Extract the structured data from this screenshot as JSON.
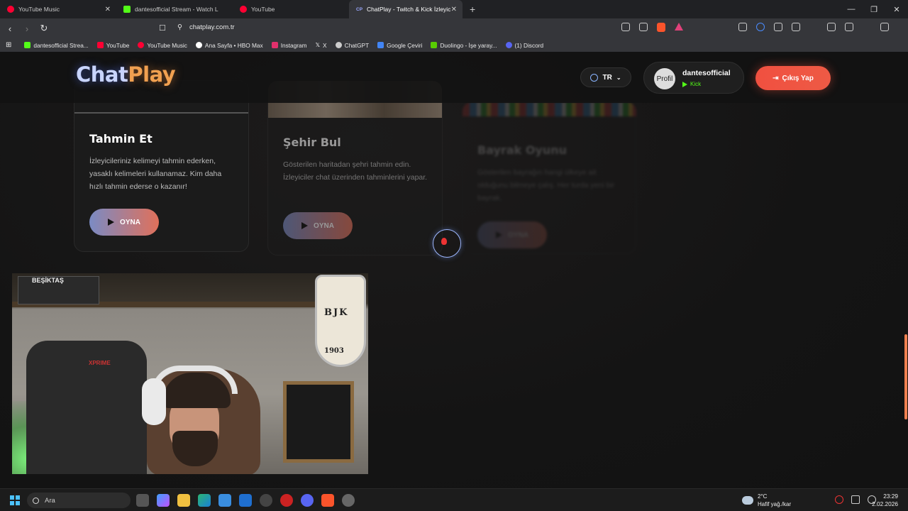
{
  "browser": {
    "tabs": [
      {
        "label": "YouTube Music",
        "color": "#ff0033"
      },
      {
        "label": "dantesofficial Stream - Watch Liv",
        "color": "#53fc18"
      },
      {
        "label": "YouTube",
        "color": "#ff0033"
      },
      {
        "label": "ChatPlay - Twitch & Kick İzleyici",
        "color": "#6b7cff",
        "fav_text": "CP",
        "active": true
      }
    ],
    "new_tab": "+",
    "url": "chatplay.com.tr",
    "bookmarks": [
      {
        "label": "dantesofficial Strea...",
        "color": "#53fc18"
      },
      {
        "label": "YouTube",
        "color": "#ff0033"
      },
      {
        "label": "YouTube Music",
        "color": "#ff0033"
      },
      {
        "label": "Ana Sayfa • HBO Max",
        "color": "#ffffff"
      },
      {
        "label": "Instagram",
        "color": "#e1306c"
      },
      {
        "label": "X",
        "color": "#ffffff"
      },
      {
        "label": "ChatGPT",
        "color": "#cccccc"
      },
      {
        "label": "Google Çeviri",
        "color": "#4285f4"
      },
      {
        "label": "Duolingo - İşe yaray...",
        "color": "#58cc02"
      },
      {
        "label": "(1) Discord",
        "color": "#5865f2"
      }
    ]
  },
  "site": {
    "logo_part1": "Chat",
    "logo_part2": "Play",
    "lang": "TR",
    "profile": {
      "name": "dantesofficial",
      "platform": "Kick",
      "avatar_alt": "Profil"
    },
    "logout_label": "Çıkış Yap",
    "cards": [
      {
        "title": "Tahmin Et",
        "desc": "İzleyicileriniz kelimeyi tahmin ederken, yasaklı kelimeleri kullanamaz. Kim daha hızlı tahmin ederse o kazanır!",
        "play_label": "OYNA"
      },
      {
        "title": "Şehir Bul",
        "desc": "Gösterilen haritadan şehri tahmin edin. İzleyiciler chat üzerinden tahminlerini yapar.",
        "play_label": "OYNA"
      },
      {
        "title": "Bayrak Oyunu",
        "desc": "Gösterilen bayrağın hangi ülkeye ait olduğunu bilmeye çalış. Her turda yeni bir bayrak.",
        "play_label": "OYNA"
      }
    ]
  },
  "webcam": {
    "sign": "BEŞİKTAŞ",
    "shield_letters": "BJK",
    "shield_year": "1903",
    "chair_brand": "XPRIME"
  },
  "taskbar": {
    "search_placeholder": "Ara",
    "weather_temp": "2°C",
    "weather_desc": "Hafif yağ./kar",
    "time": "23:29",
    "date": "2.02.2026"
  },
  "colors": {
    "accent": "#f05040",
    "kick": "#53fc18",
    "page_bg": "#141414"
  }
}
